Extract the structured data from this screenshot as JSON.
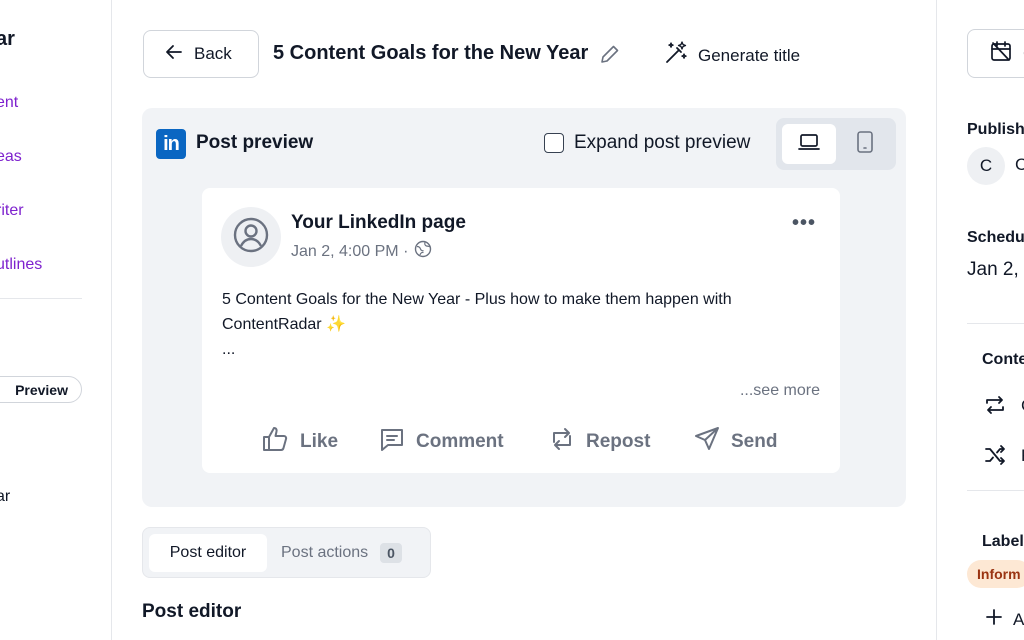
{
  "sidebar": {
    "brand": "ar",
    "links": [
      "ent",
      "eas",
      "riter",
      "utlines"
    ],
    "preview_label": "Preview",
    "bottom_text": "ar"
  },
  "header": {
    "back_label": "Back",
    "post_title": "5 Content Goals for the New Year",
    "generate_label": "Generate title"
  },
  "preview": {
    "label": "Post preview",
    "expand_label": "Expand post preview",
    "card": {
      "page_name": "Your LinkedIn page",
      "timestamp": "Jan 2, 4:00 PM ·",
      "body_line1": "5 Content Goals for the New Year - Plus how to make them happen with",
      "body_line2": "ContentRadar ✨",
      "body_line3": "...",
      "see_more": "...see more",
      "actions": {
        "like": "Like",
        "comment": "Comment",
        "repost": "Repost",
        "send": "Send"
      }
    }
  },
  "tabs": {
    "editor": "Post editor",
    "actions": "Post actions",
    "actions_count": "0"
  },
  "editor_heading": "Post editor",
  "right_panel": {
    "cal_btn_letter": "C",
    "publish_label": "Publish",
    "avatar_letter": "C",
    "publisher_letter": "C",
    "schedule_label": "Schedu",
    "schedule_value": "Jan 2,",
    "content_label": "Conte",
    "content_item1_letter": "C",
    "content_item2_letter": "F",
    "labels_label": "Label",
    "label_badge": "Inform",
    "add_letter": "A"
  },
  "colors": {
    "accent_purple": "#7e22ce",
    "linkedin_blue": "#0a66c2",
    "panel_gray": "#f1f3f6"
  }
}
